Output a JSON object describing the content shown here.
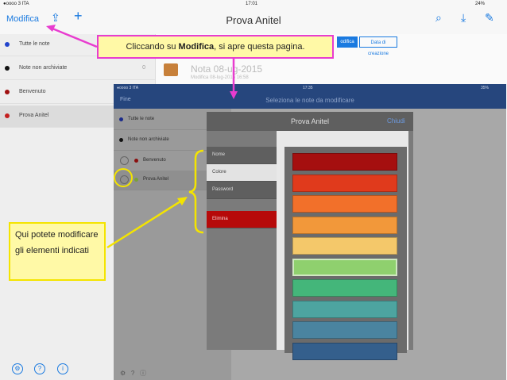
{
  "statusbar": {
    "carrier": "●oooo 3 ITA",
    "time": "17:01",
    "battery": "24%"
  },
  "navbar": {
    "edit_label": "Modifica",
    "title": "Prova Anitel"
  },
  "sidebar": {
    "items": [
      {
        "label": "Tutte le note",
        "count": "1",
        "color": "#2244cc"
      },
      {
        "label": "Note non archiviate",
        "count": "0",
        "color": "#111111"
      },
      {
        "label": "Benvenuto",
        "count": "",
        "color": "#a01010"
      },
      {
        "label": "Prova Anitel",
        "count": "",
        "color": "#c42020"
      }
    ]
  },
  "background_note": {
    "title": "Nota 08-ug-2015",
    "subtitle": "Modifica 08-lug-2015 16:58",
    "tab_active": "odifica",
    "tab_other": "Data di creazione"
  },
  "inner": {
    "status": {
      "carrier": "●oooo 3 ITA",
      "time": "17:35",
      "battery": "35%"
    },
    "nav": {
      "done_label": "Fine",
      "title": "Seleziona le note da modificare"
    },
    "sidebar": {
      "items": [
        {
          "label": "Tutte le note",
          "color": "#1a2a8a"
        },
        {
          "label": "Note non archiviate",
          "color": "#111111"
        },
        {
          "label": "Benvenuto",
          "color": "#8a0f0f"
        },
        {
          "label": "Prova Anitel",
          "color": "#7aa03a"
        }
      ]
    },
    "modal": {
      "title": "Prova Anitel",
      "close_label": "Chiudi",
      "menu": [
        "Nome",
        "Colore",
        "Password",
        "Elimina"
      ],
      "swatches": [
        "#a50f0f",
        "#e03a1c",
        "#f2702a",
        "#f2983a",
        "#f4c86a",
        "#8fd06e",
        "#44b67a",
        "#4da4a0",
        "#4a84a0",
        "#345f8c"
      ]
    }
  },
  "callouts": {
    "top_pre": "Cliccando su ",
    "top_bold": "Modifica",
    "top_post": ", si apre questa pagina.",
    "left_text": "Qui potete modificare gli elementi indicati"
  },
  "colors": {
    "accent": "#1a7ae0",
    "callout_top_border": "#e83ccf",
    "callout_left_border": "#f4e400",
    "elimina": "#b60a0a"
  }
}
